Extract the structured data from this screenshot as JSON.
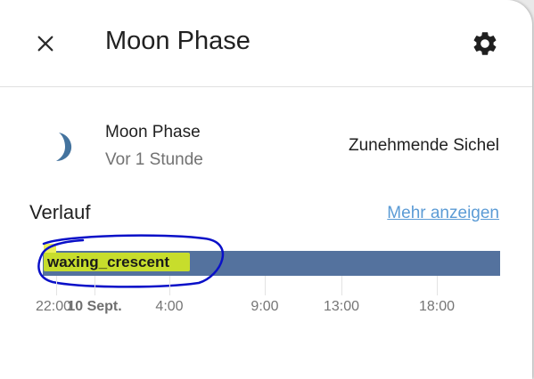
{
  "dialog": {
    "title": "Moon Phase",
    "close_icon": "close-icon",
    "settings_icon": "gear-icon"
  },
  "entity": {
    "icon": "moon-waxing-crescent-icon",
    "name": "Moon Phase",
    "last_changed": "Vor 1 Stunde",
    "state": "Zunehmende Sichel"
  },
  "history": {
    "title": "Verlauf",
    "more_link": "Mehr anzeigen",
    "bar_state": "waxing_crescent",
    "bar_color": "#54729e",
    "highlight_color": "#c7dd2c",
    "annotation_color": "#0a10c8",
    "ticks": [
      "22:00",
      "10 Sept.",
      "4:00",
      "9:00",
      "13:00",
      "18:00"
    ]
  }
}
